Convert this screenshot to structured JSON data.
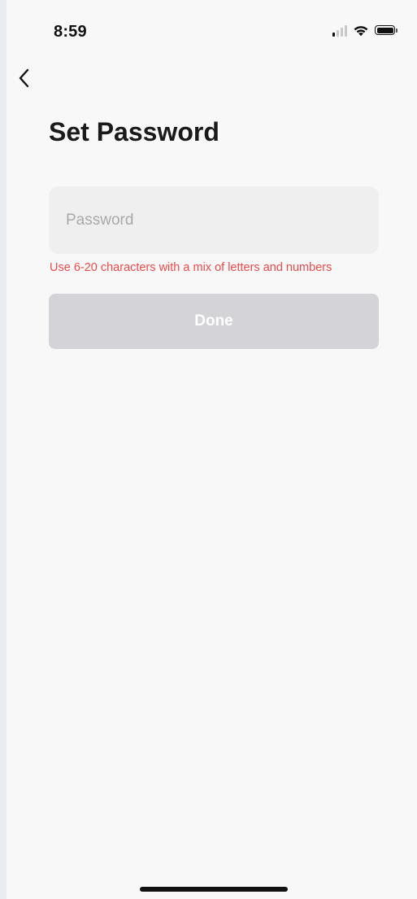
{
  "status_bar": {
    "time": "8:59",
    "signal_icon": "signal-bars-icon",
    "wifi_icon": "wifi-icon",
    "battery_icon": "battery-icon",
    "signal_active_bars": 1,
    "signal_total_bars": 4,
    "battery_level": 1.0
  },
  "header": {
    "back_icon": "chevron-left-icon",
    "title": "Set Password"
  },
  "form": {
    "password": {
      "value": "",
      "placeholder": "Password"
    },
    "hint": "Use 6-20 characters with a mix of letters and numbers",
    "done_label": "Done"
  },
  "colors": {
    "hint_red": "#ef4a4a",
    "disabled_button": "#d4d4d8",
    "field_background": "#efefef",
    "screen_background": "#f8f8f8"
  }
}
